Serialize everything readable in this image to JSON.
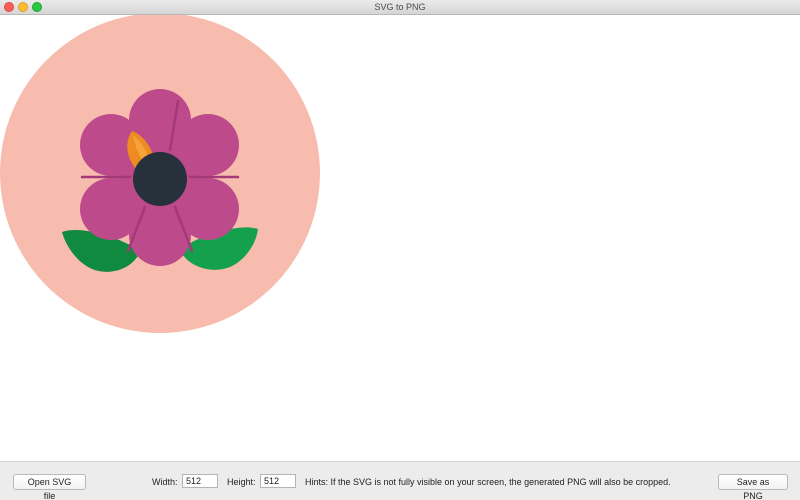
{
  "window": {
    "title": "SVG to PNG"
  },
  "preview": {
    "description_icon": "flower-icon",
    "colors": {
      "background_circle": "#f8bcae",
      "petal": "#bd4a8b",
      "petal_shadow": "#a33a78",
      "center": "#27313b",
      "bud": "#ee8b21",
      "bud_light": "#f7a23a",
      "leaf_dark": "#0f8a3f",
      "leaf_light": "#15a04e"
    }
  },
  "toolbar": {
    "open_label": "Open SVG file",
    "width_label": "Width:",
    "width_value": "512",
    "height_label": "Height:",
    "height_value": "512",
    "hint": "Hints: If the SVG is not fully visible on your screen, the generated PNG will also be cropped.",
    "save_label": "Save as PNG"
  }
}
